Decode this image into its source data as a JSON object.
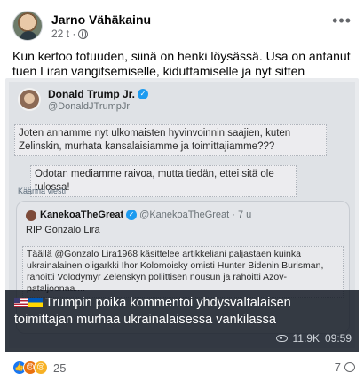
{
  "post": {
    "author": "Jarno Vähäkainu",
    "time": "22 t ·",
    "text": "Kun kertoo totuuden, siinä on henki löysässä. Usa on antanut tuen Liran vangitsemiselle, kiduttamiselle ja nyt sitten  tappamiselle."
  },
  "media": {
    "tweet": {
      "name": "Donald Trump Jr.",
      "handle": "@DonaldJTrumpJr",
      "text1": "Joten annamme nyt ulkomaisten hyvinvoinnin saajien, kuten Zelinskin, murhata kansalaisiamme ja toimittajiamme???",
      "text2": "Odotan mediamme raivoa, mutta tiedän, ettei sitä ole tulossa!",
      "translate": "Käännä viesti"
    },
    "quote": {
      "name": "KanekoaTheGreat",
      "handle": "@KanekoaTheGreat · 7 u",
      "rip": "RIP Gonzalo Lira",
      "body": "Täällä @Gonzalo Lira1968 käsittelee artikkeliani paljastaen kuinka ukrainalainen oligarkki Ihor Kolomoisky omisti Hunter Bidenin Burisman, rahoitti Volodymyr Zelenskyn poliittisen nousun ja rahoitti Azov-pataljoonaa...."
    },
    "caption": "Trumpin poika kommentoi yhdysvaltalaisen toimittajan murhaa ukrainalaisessa vankilassa",
    "views": "11.9K",
    "duration": "09:59"
  },
  "footer": {
    "reaction_count": "25",
    "comment_count": "7"
  },
  "icons": {
    "more": "more-horizontal-icon",
    "audience": "globe-icon",
    "views": "eye-icon",
    "comments": "comment-icon"
  },
  "colors": {
    "secondary_text": "#65676b",
    "like_blue": "#1877f2",
    "verified_blue": "#1d9bf0"
  }
}
